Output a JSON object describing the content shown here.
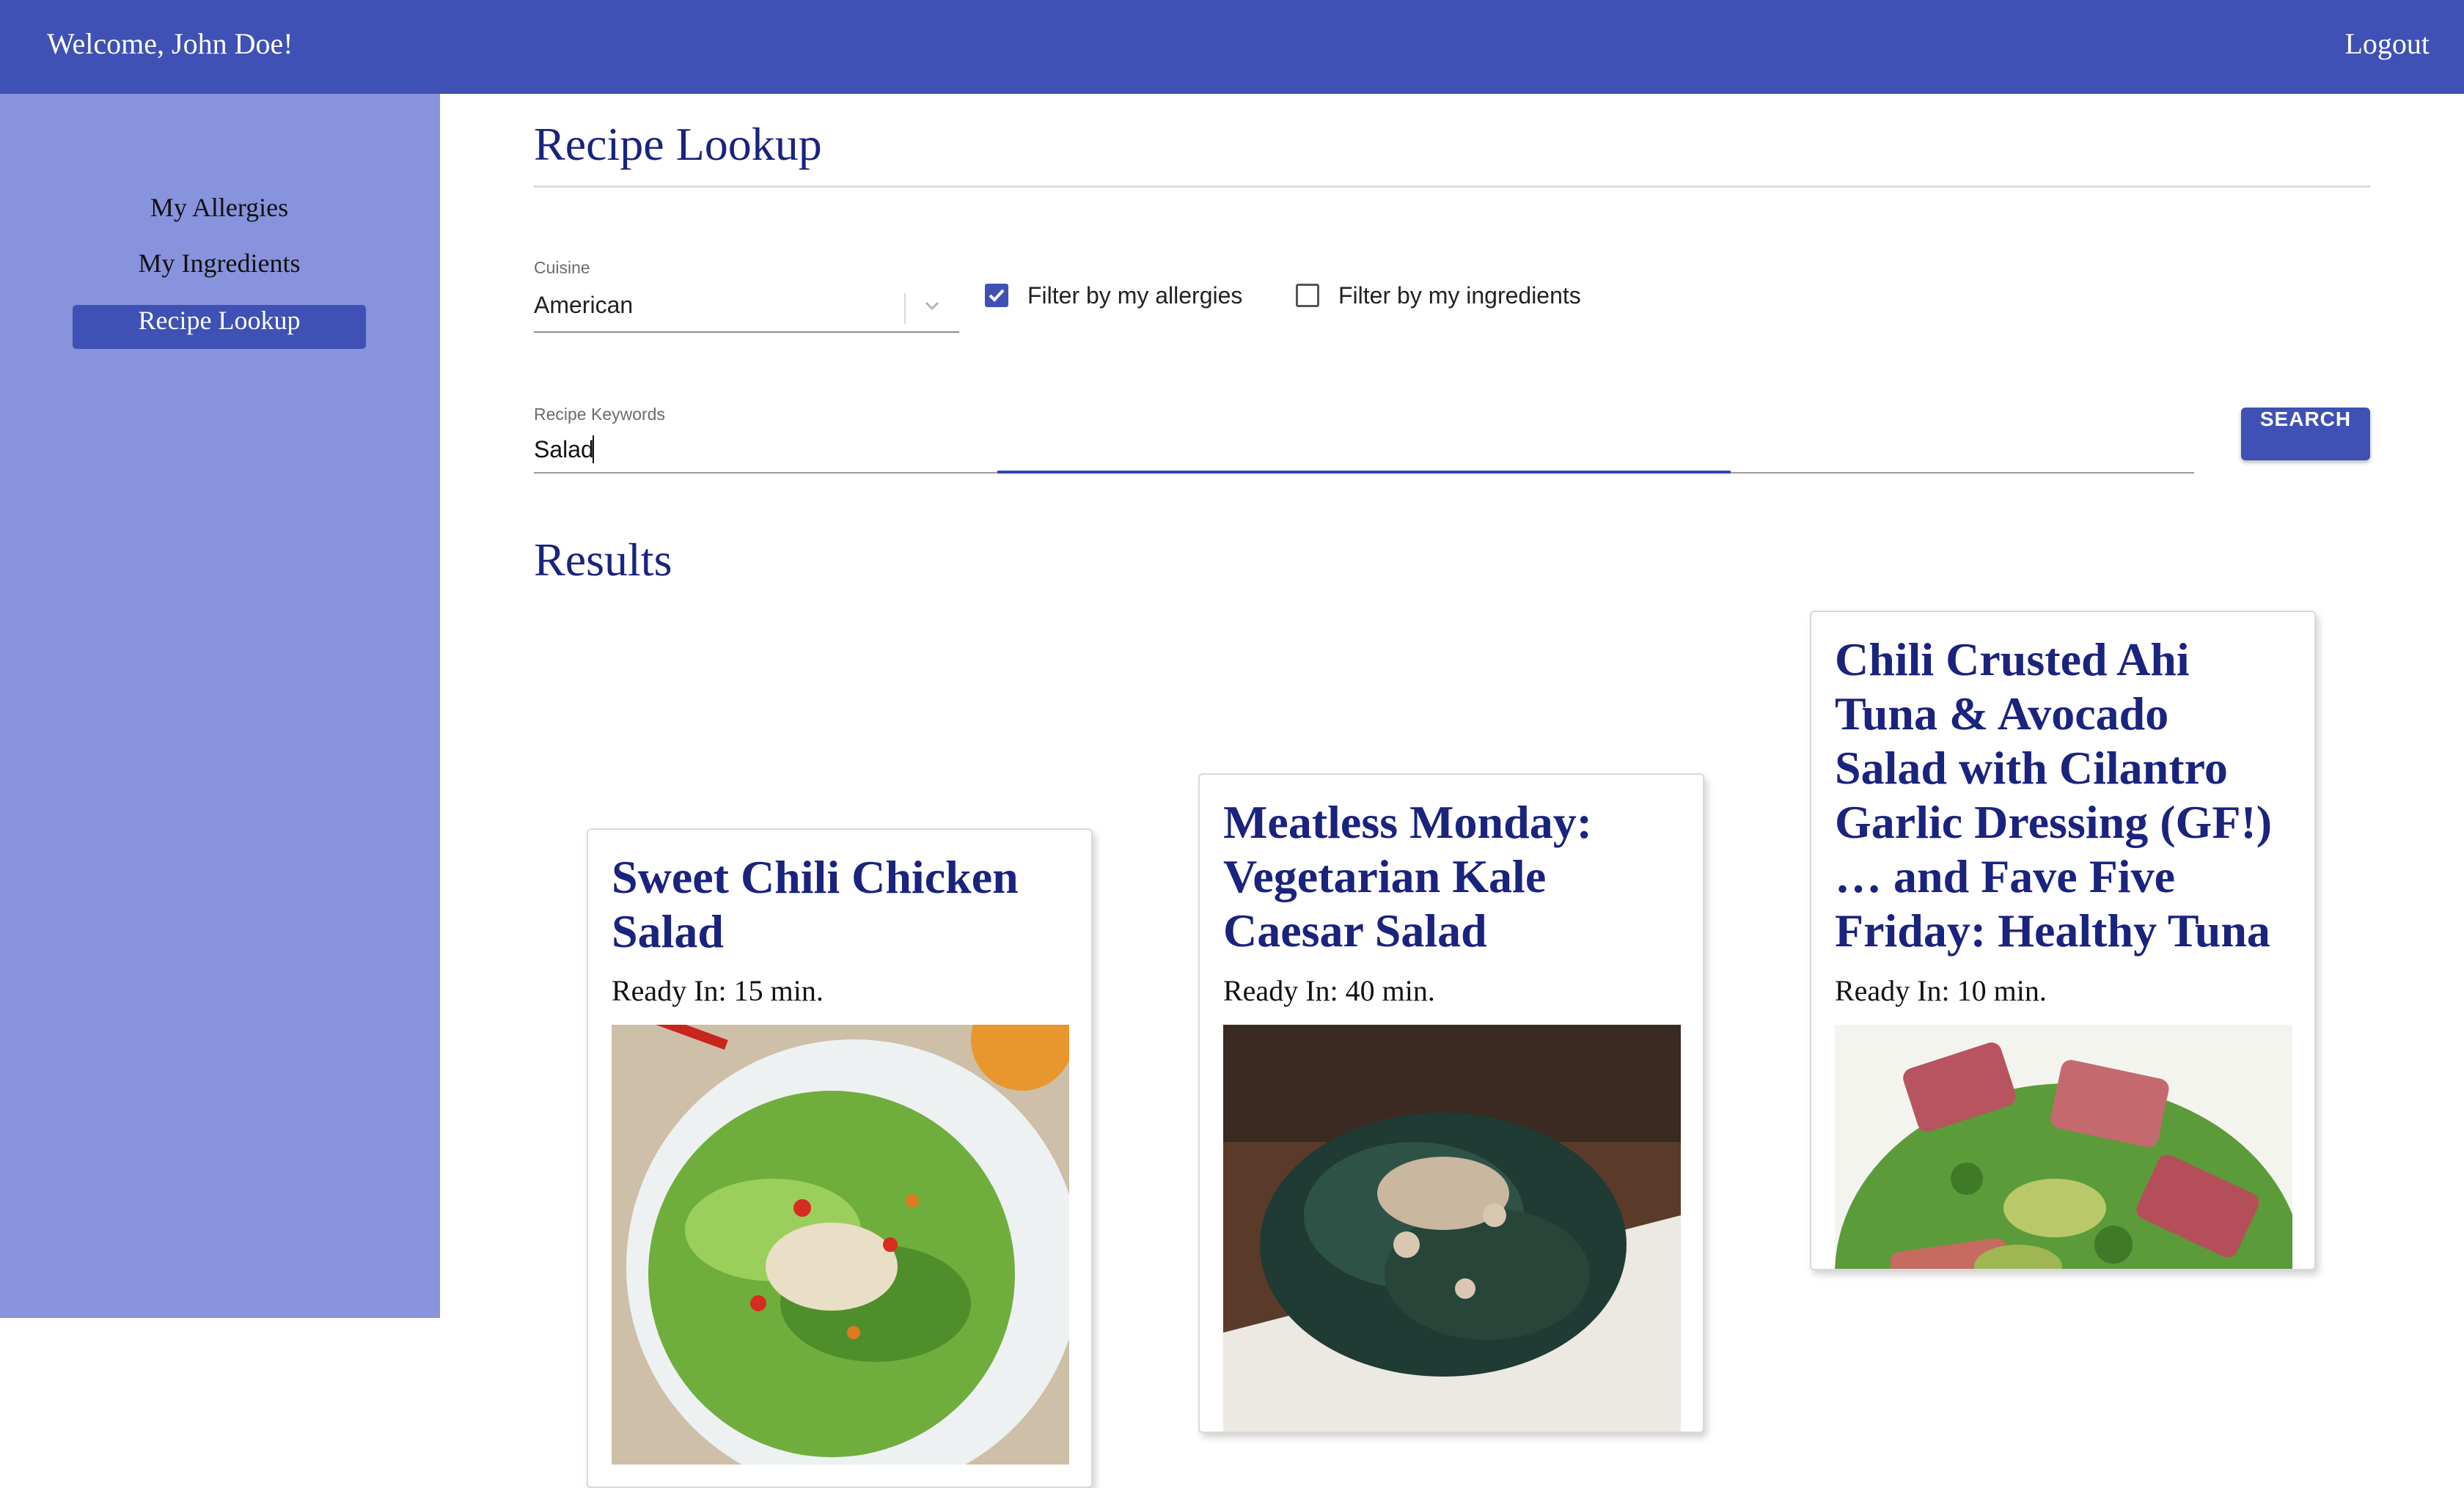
{
  "header": {
    "welcome": "Welcome, John Doe!",
    "logout": "Logout"
  },
  "sidebar": {
    "items": [
      {
        "label": "My Allergies"
      },
      {
        "label": "My Ingredients"
      },
      {
        "label": "Recipe Lookup",
        "active": true
      }
    ]
  },
  "main": {
    "title": "Recipe Lookup",
    "cuisine": {
      "label": "Cuisine",
      "value": "American"
    },
    "filters": [
      {
        "label": "Filter by my allergies",
        "checked": true
      },
      {
        "label": "Filter by my ingredients",
        "checked": false
      }
    ],
    "keywords": {
      "label": "Recipe Keywords",
      "value": "Salad"
    },
    "search_label": "SEARCH",
    "results_title": "Results",
    "results": [
      {
        "title": "Sweet Chili Chicken Salad",
        "ready": "Ready In: 15 min.",
        "image_icon": "chicken-salad-photo"
      },
      {
        "title": "Meatless Monday: Vegetarian Kale Caesar Salad",
        "ready": "Ready In: 40 min.",
        "image_icon": "kale-caesar-photo"
      },
      {
        "title": "Chili Crusted Ahi Tuna & Avocado Salad with Cilantro Garlic Dressing (GF!) … and Fave Five Friday: Healthy Tuna",
        "ready": "Ready In: 10 min.",
        "image_icon": "ahi-tuna-salad-photo"
      }
    ]
  },
  "colors": {
    "primary": "#3f51b5",
    "sidebar": "#8893dd",
    "heading": "#1a237e"
  }
}
